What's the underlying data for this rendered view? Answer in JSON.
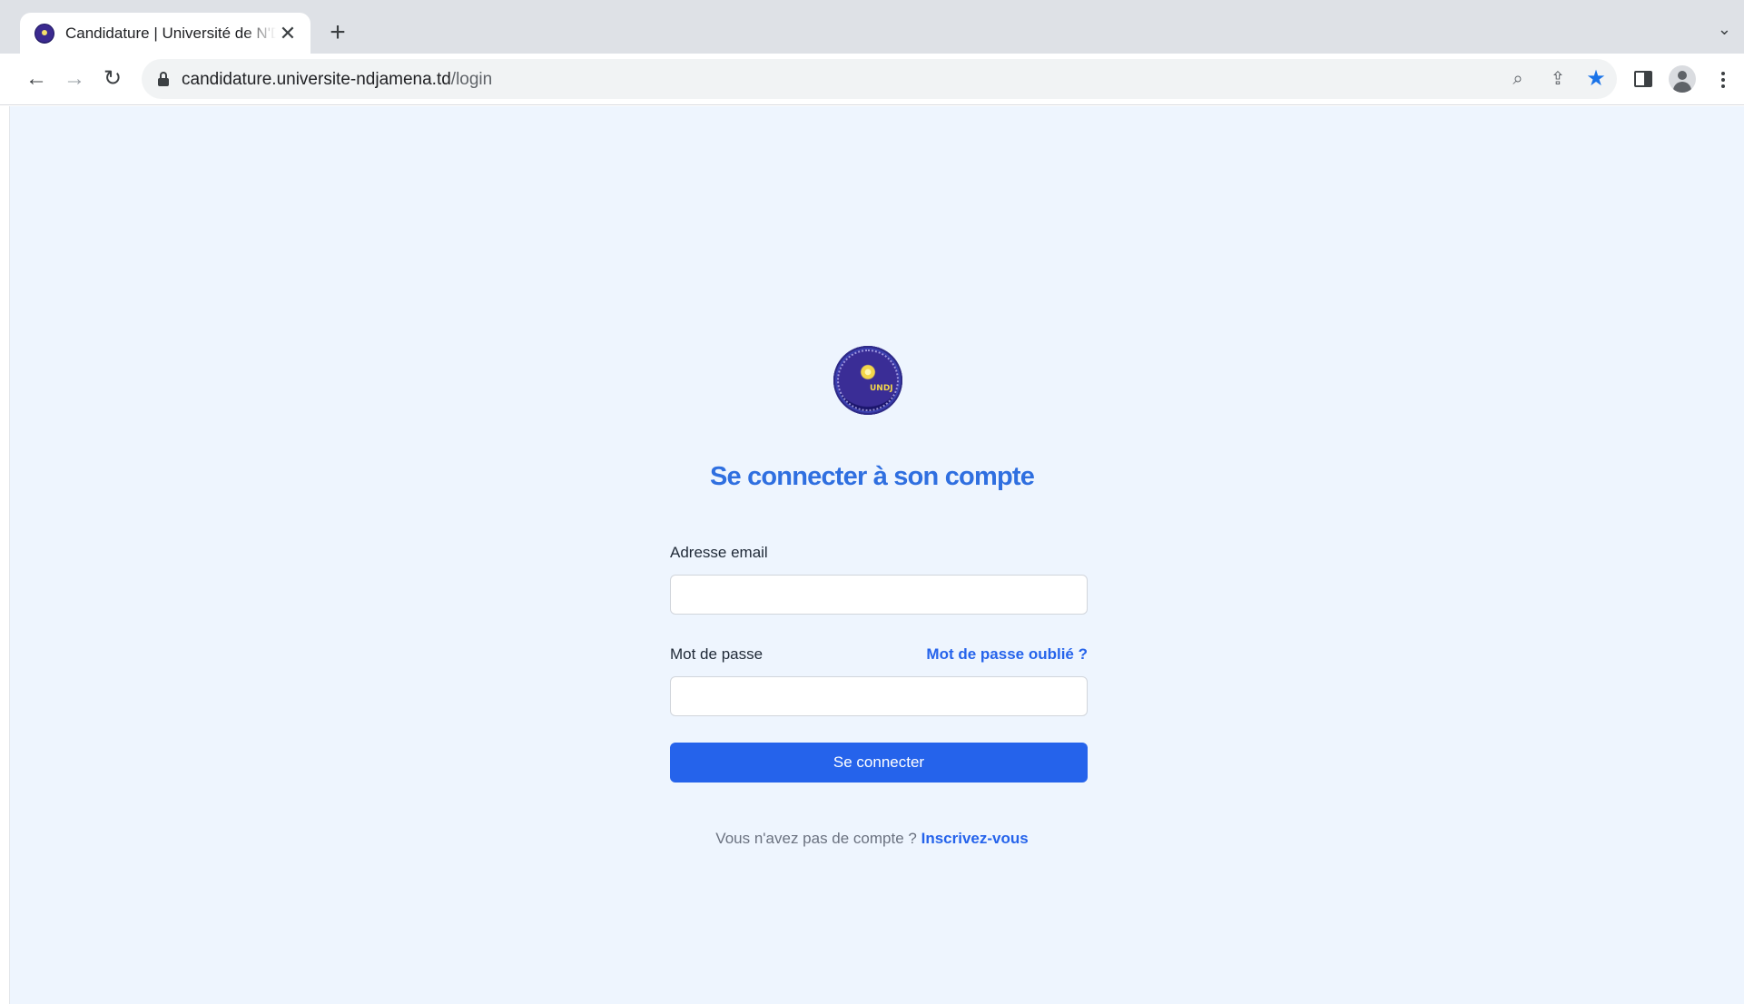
{
  "browser": {
    "tab_title": "Candidature | Université de N'Djamena",
    "tab_close": "✕",
    "new_tab": "+",
    "url_host": "candidature.universite-ndjamena.td",
    "url_path": "/login",
    "icons": [
      "back-arrow-icon",
      "forward-arrow-icon",
      "reload-icon",
      "lock-icon",
      "zoom-icon",
      "share-icon",
      "bookmark-star-icon",
      "side-panel-icon",
      "profile-icon",
      "menu-icon",
      "tab-list-icon"
    ]
  },
  "login": {
    "logo_text": "UNDJ",
    "title": "Se connecter à son compte",
    "email_label": "Adresse email",
    "email_value": "",
    "password_label": "Mot de passe",
    "password_value": "",
    "forgot_link": "Mot de passe oublié ?",
    "submit_label": "Se connecter",
    "signup_prompt": "Vous n'avez pas de compte ?",
    "signup_link": "Inscrivez-vous"
  },
  "colors": {
    "accent": "#2563eb",
    "page_background": "#eef5fe",
    "title_color": "#2f6fe0"
  }
}
